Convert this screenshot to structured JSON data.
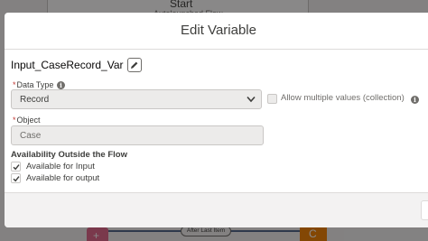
{
  "background": {
    "start_label": "Start",
    "start_sublabel": "Autolaunched Flow",
    "connector_label": "After Last Item"
  },
  "modal": {
    "title": "Edit Variable",
    "variable_name": "Input_CaseRecord_Var",
    "data_type": {
      "label": "Data Type",
      "value": "Record"
    },
    "multiple_values": {
      "label": "Allow multiple values (collection)",
      "checked": false
    },
    "object": {
      "label": "Object",
      "value": "Case"
    },
    "availability": {
      "heading": "Availability Outside the Flow",
      "input_label": "Available for Input",
      "output_label": "Available for output"
    }
  },
  "colors": {
    "modal_bg": "#ffffff",
    "overlay": "#080707",
    "field_disabled_bg": "#ecebea",
    "required_marker": "#c23934",
    "node_pink": "#e2698c",
    "node_orange": "#f38303"
  },
  "icons": [
    "pencil-icon",
    "info-icon",
    "chevron-down-icon",
    "checkmark-icon",
    "plus-icon"
  ]
}
